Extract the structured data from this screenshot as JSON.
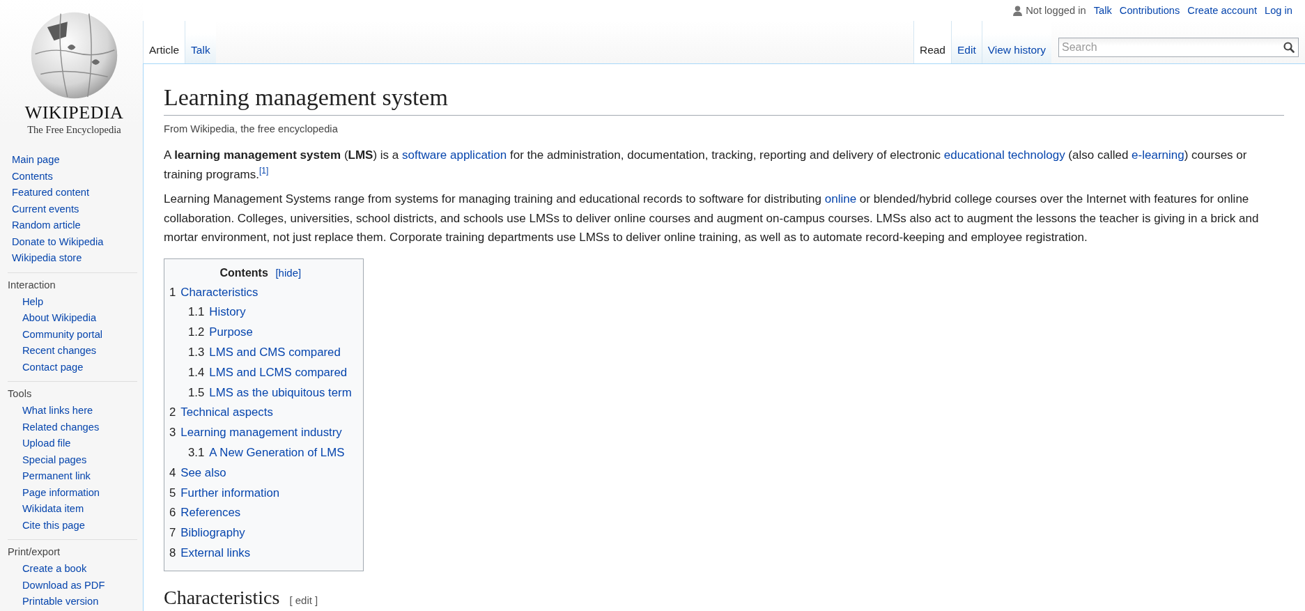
{
  "logo": {
    "wordmark": "WIKIPEDIA",
    "tagline": "The Free Encyclopedia"
  },
  "personal": {
    "status": "Not logged in",
    "links": [
      "Talk",
      "Contributions",
      "Create account",
      "Log in"
    ]
  },
  "namespace_tabs": [
    {
      "label": "Article",
      "selected": true
    },
    {
      "label": "Talk",
      "selected": false
    }
  ],
  "view_tabs": [
    {
      "label": "Read",
      "selected": true
    },
    {
      "label": "Edit",
      "selected": false
    },
    {
      "label": "View history",
      "selected": false
    }
  ],
  "search": {
    "placeholder": "Search"
  },
  "sidebar": [
    {
      "items": [
        "Main page",
        "Contents",
        "Featured content",
        "Current events",
        "Random article",
        "Donate to Wikipedia",
        "Wikipedia store"
      ]
    },
    {
      "heading": "Interaction",
      "items": [
        "Help",
        "About Wikipedia",
        "Community portal",
        "Recent changes",
        "Contact page"
      ]
    },
    {
      "heading": "Tools",
      "items": [
        "What links here",
        "Related changes",
        "Upload file",
        "Special pages",
        "Permanent link",
        "Page information",
        "Wikidata item",
        "Cite this page"
      ]
    },
    {
      "heading": "Print/export",
      "items": [
        "Create a book",
        "Download as PDF",
        "Printable version"
      ]
    }
  ],
  "article": {
    "title": "Learning management system",
    "tagline": "From Wikipedia, the free encyclopedia",
    "paragraphs": [
      [
        {
          "kind": "text",
          "text": "A "
        },
        {
          "kind": "bold",
          "text": "learning management system"
        },
        {
          "kind": "text",
          "text": " ("
        },
        {
          "kind": "bold",
          "text": "LMS"
        },
        {
          "kind": "text",
          "text": ") is a "
        },
        {
          "kind": "link",
          "text": "software application"
        },
        {
          "kind": "text",
          "text": " for the administration, documentation, tracking, reporting and delivery of electronic "
        },
        {
          "kind": "link",
          "text": "educational technology"
        },
        {
          "kind": "text",
          "text": " (also called "
        },
        {
          "kind": "link",
          "text": "e-learning"
        },
        {
          "kind": "text",
          "text": ") courses or training programs."
        },
        {
          "kind": "ref",
          "text": "[1]"
        }
      ],
      [
        {
          "kind": "text",
          "text": "Learning Management Systems range from systems for managing training and educational records to software for distributing "
        },
        {
          "kind": "link",
          "text": "online"
        },
        {
          "kind": "text",
          "text": " or blended/hybrid college courses over the Internet with features for online collaboration. Colleges, universities, school districts, and schools use LMSs to deliver online courses and augment on-campus courses. LMSs also act to augment the lessons the teacher is giving in a brick and mortar environment, not just replace them. Corporate training departments use LMSs to deliver online training, as well as to automate record-keeping and employee registration."
        }
      ]
    ],
    "toc": {
      "title": "Contents",
      "toggle": "[hide]",
      "entries": [
        {
          "number": "1",
          "text": "Characteristics",
          "children": [
            {
              "number": "1.1",
              "text": "History"
            },
            {
              "number": "1.2",
              "text": "Purpose"
            },
            {
              "number": "1.3",
              "text": "LMS and CMS compared"
            },
            {
              "number": "1.4",
              "text": "LMS and LCMS compared"
            },
            {
              "number": "1.5",
              "text": "LMS as the ubiquitous term"
            }
          ]
        },
        {
          "number": "2",
          "text": "Technical aspects"
        },
        {
          "number": "3",
          "text": "Learning management industry",
          "children": [
            {
              "number": "3.1",
              "text": "A New Generation of LMS"
            }
          ]
        },
        {
          "number": "4",
          "text": "See also"
        },
        {
          "number": "5",
          "text": "Further information"
        },
        {
          "number": "6",
          "text": "References"
        },
        {
          "number": "7",
          "text": "Bibliography"
        },
        {
          "number": "8",
          "text": "External links"
        }
      ]
    },
    "section_heading": {
      "title": "Characteristics",
      "edit": "[ edit ]"
    }
  }
}
